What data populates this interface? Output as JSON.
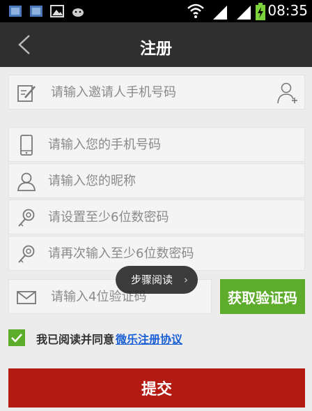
{
  "status_bar": {
    "time": "08:35",
    "icons": [
      "sim-icon",
      "sim-icon",
      "picture-icon",
      "android-icon",
      "wifi-icon",
      "signal-icon",
      "signal-icon",
      "battery-charging-icon"
    ]
  },
  "header": {
    "title": "注册",
    "back_icon": "chevron-left-icon"
  },
  "form": {
    "invite_placeholder": "请输入邀请人手机号码",
    "phone_placeholder": "请输入您的手机号码",
    "nickname_placeholder": "请输入您的昵称",
    "password_placeholder": "请设置至少6位数密码",
    "password_confirm_placeholder": "请再次输入至少6位数密码",
    "code_placeholder": "请输入4位验证码",
    "get_code_label": "获取验证码"
  },
  "toast": {
    "label": "步骤阅读",
    "arrow": "›"
  },
  "agreement": {
    "checked": true,
    "text": "我已阅读并同意",
    "link": "微乐注册协议"
  },
  "submit_label": "提交",
  "colors": {
    "accent_green": "#5dac2c",
    "submit_red": "#b31a12",
    "title_bar": "#2f2f2f"
  }
}
